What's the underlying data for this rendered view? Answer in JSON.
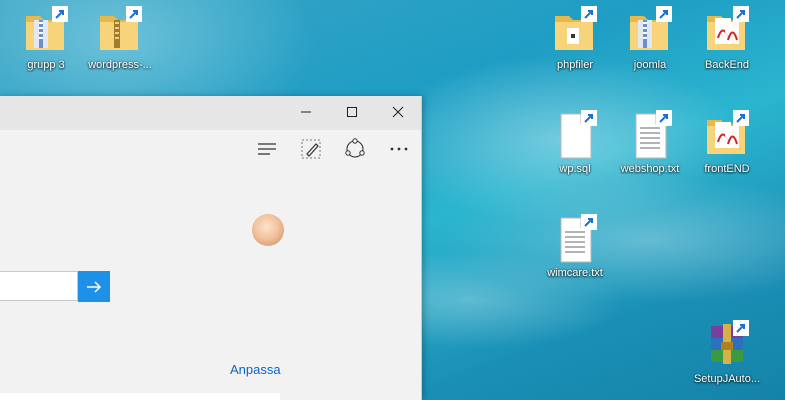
{
  "desktop": {
    "icons": [
      {
        "label": "grupp 3",
        "type": "folder-zip"
      },
      {
        "label": "wordpress-...",
        "type": "folder-zip"
      },
      {
        "label": "phpfiler",
        "type": "folder"
      },
      {
        "label": "joomla",
        "type": "folder-zip"
      },
      {
        "label": "BackEnd",
        "type": "folder-pdf"
      },
      {
        "label": "wp.sql",
        "type": "file-blank"
      },
      {
        "label": "webshop.txt",
        "type": "file-text"
      },
      {
        "label": "frontEND",
        "type": "folder-pdf"
      },
      {
        "label": "wimcare.txt",
        "type": "file-text"
      },
      {
        "label": "SetupJAuto...",
        "type": "winrar"
      }
    ]
  },
  "browser": {
    "controls": {
      "minimize": "minimize-icon",
      "maximize": "maximize-icon",
      "close": "close-icon"
    },
    "toolbar": {
      "hub": "hub-icon",
      "notes": "web-note-icon",
      "share": "share-icon",
      "more": "more-icon"
    },
    "search": {
      "value": "",
      "placeholder": ""
    },
    "customize_link": "Anpassa"
  },
  "colors": {
    "accent": "#1e90e8",
    "link": "#0a64c8",
    "desktop": "#1f9dc4"
  }
}
